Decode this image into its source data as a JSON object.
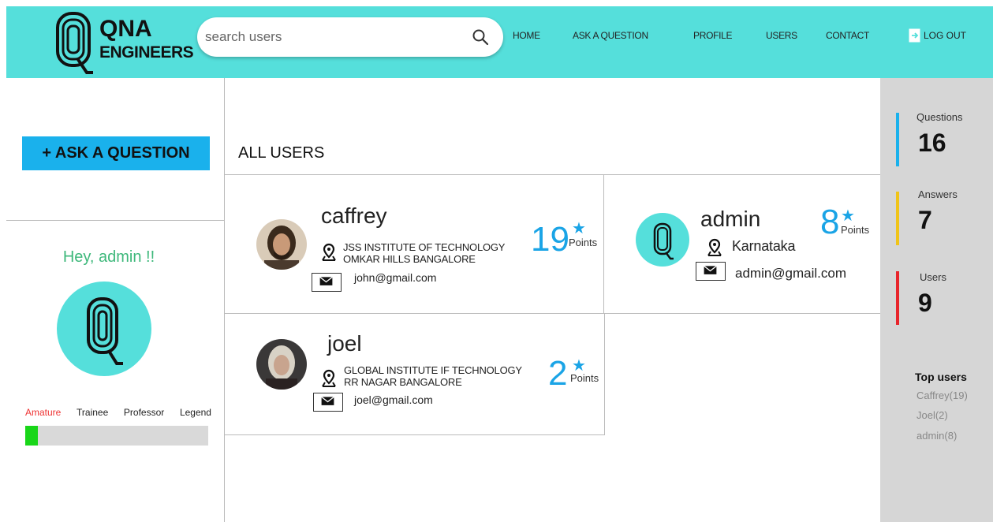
{
  "header": {
    "logo_line1": "QNA",
    "logo_line2": "ENGINEERS",
    "search_placeholder": "search users",
    "nav": [
      "HOME",
      "ASK A QUESTION",
      "PROFILE",
      "USERS",
      "CONTACT"
    ],
    "logout_label": "LOG OUT"
  },
  "left": {
    "ask_button": "+ ASK A QUESTION",
    "greeting": "Hey, admin !!",
    "levels": [
      "Amature",
      "Trainee",
      "Professor",
      "Legend"
    ],
    "active_level": "Amature",
    "progress_fraction": 0.07
  },
  "main": {
    "title": "ALL USERS",
    "users": [
      {
        "name": "caffrey",
        "location_line1": "JSS INSTITUTE OF TECHNOLOGY",
        "location_line2": "OMKAR HILLS BANGALORE",
        "email": "john@gmail.com",
        "points": "19",
        "points_label": "Points"
      },
      {
        "name": "admin",
        "location_line1": "Karnataka",
        "location_line2": "",
        "email": "admin@gmail.com",
        "points": "8",
        "points_label": "Points"
      },
      {
        "name": "joel",
        "location_line1": "GLOBAL INSTITUTE IF TECHNOLOGY",
        "location_line2": "RR NAGAR BANGALORE",
        "email": "joel@gmail.com",
        "points": "2",
        "points_label": "Points"
      }
    ]
  },
  "right": {
    "stats": [
      {
        "label": "Questions",
        "value": "16",
        "color": "#1ab1ec"
      },
      {
        "label": "Answers",
        "value": "7",
        "color": "#f0c419"
      },
      {
        "label": "Users",
        "value": "9",
        "color": "#e8252b"
      }
    ],
    "top_users_title": "Top users",
    "top_users": [
      "Caffrey(19)",
      "Joel(2)",
      "admin(8)"
    ]
  },
  "colors": {
    "header": "#55dfdb",
    "accent_blue": "#1ab1ec",
    "progress": "#19d619",
    "greeting": "#3eb87b"
  }
}
